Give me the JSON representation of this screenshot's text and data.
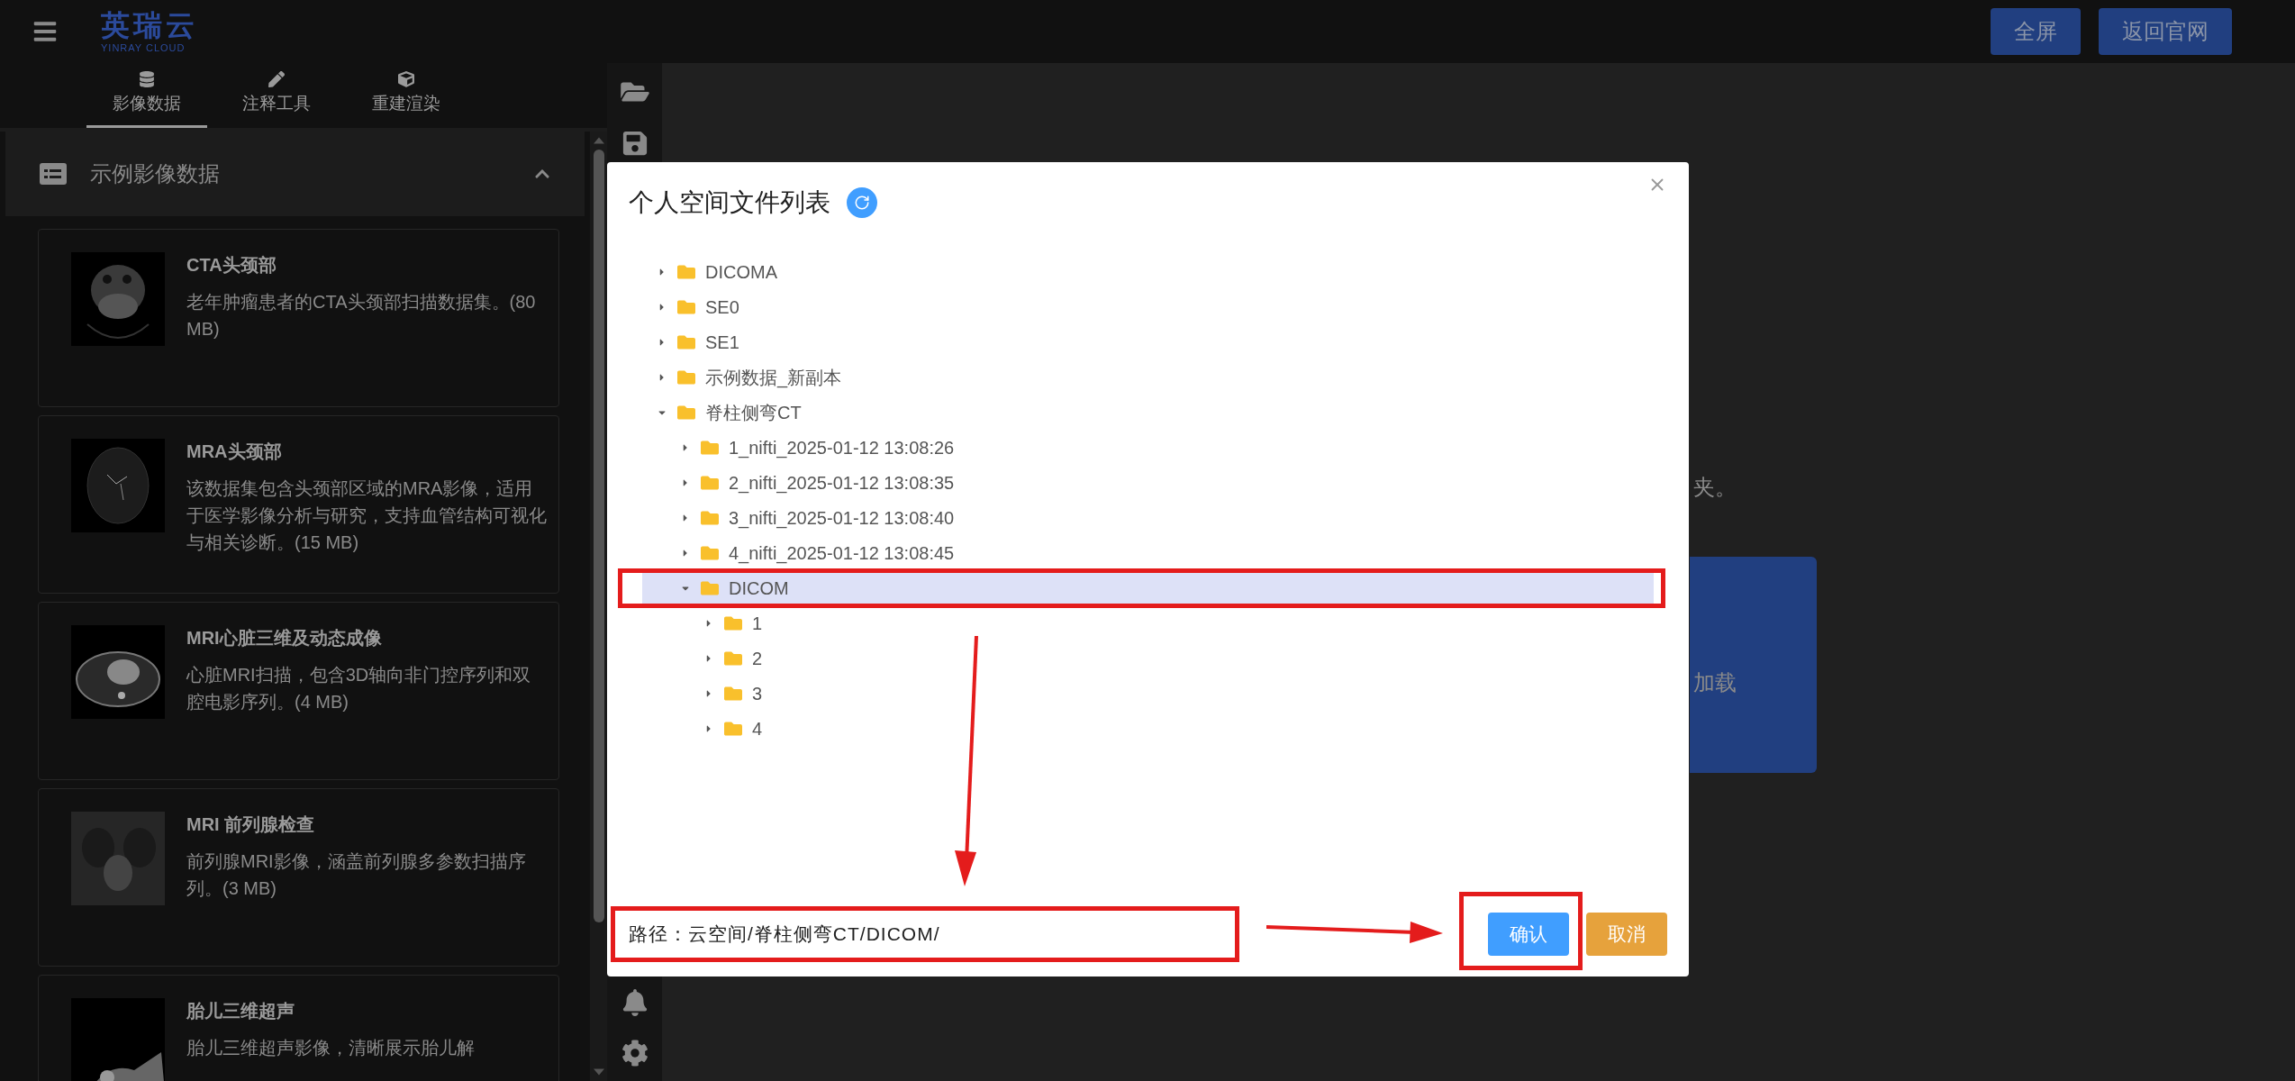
{
  "header": {
    "logo": {
      "name": "英瑞云",
      "tagline": "YINRAY CLOUD"
    },
    "buttons": [
      "全屏",
      "返回官网"
    ]
  },
  "left_panel": {
    "tabs": [
      {
        "label": "影像数据",
        "selected": true
      },
      {
        "label": "注释工具",
        "selected": false
      },
      {
        "label": "重建渲染",
        "selected": false
      }
    ],
    "section": {
      "title": "示例影像数据",
      "expanded": true
    },
    "datasets": [
      {
        "title": "CTA头颈部",
        "description": "老年肿瘤患者的CTA头颈部扫描数据集。(80 MB)"
      },
      {
        "title": "MRA头颈部",
        "description": "该数据集包含头颈部区域的MRA影像，适用于医学影像分析与研究，支持血管结构可视化与相关诊断。(15 MB)"
      },
      {
        "title": "MRI心脏三维及动态成像",
        "description": "心脏MRI扫描，包含3D轴向非门控序列和双腔电影序列。(4 MB)"
      },
      {
        "title": "MRI 前列腺检查",
        "description": "前列腺MRI影像，涵盖前列腺多参数扫描序列。(3 MB)"
      },
      {
        "title": "胎儿三维超声",
        "description": "胎儿三维超声影像，清晰展示胎儿解"
      }
    ]
  },
  "main": {
    "hint_text": "夹。",
    "load_button": "加载"
  },
  "dialog": {
    "title": "个人空间文件列表",
    "tree": [
      {
        "label": "DICOMA",
        "expanded": false,
        "selected": false
      },
      {
        "label": "SE0",
        "expanded": false,
        "selected": false
      },
      {
        "label": "SE1",
        "expanded": false,
        "selected": false
      },
      {
        "label": "示例数据_新副本",
        "expanded": false,
        "selected": false
      },
      {
        "label": "脊柱侧弯CT",
        "expanded": true,
        "selected": false,
        "children": [
          {
            "label": "1_nifti_2025-01-12 13:08:26",
            "expanded": false,
            "selected": false
          },
          {
            "label": "2_nifti_2025-01-12 13:08:35",
            "expanded": false,
            "selected": false
          },
          {
            "label": "3_nifti_2025-01-12 13:08:40",
            "expanded": false,
            "selected": false
          },
          {
            "label": "4_nifti_2025-01-12 13:08:45",
            "expanded": false,
            "selected": false
          },
          {
            "label": "DICOM",
            "expanded": true,
            "selected": true,
            "children": [
              {
                "label": "1",
                "expanded": false,
                "selected": false
              },
              {
                "label": "2",
                "expanded": false,
                "selected": false
              },
              {
                "label": "3",
                "expanded": false,
                "selected": false
              },
              {
                "label": "4",
                "expanded": false,
                "selected": false
              }
            ]
          }
        ]
      }
    ],
    "path": "路径：云空间/脊柱侧弯CT/DICOM/",
    "buttons": [
      {
        "label": "确认",
        "kind": "primary"
      },
      {
        "label": "取消",
        "kind": "warning"
      }
    ]
  }
}
